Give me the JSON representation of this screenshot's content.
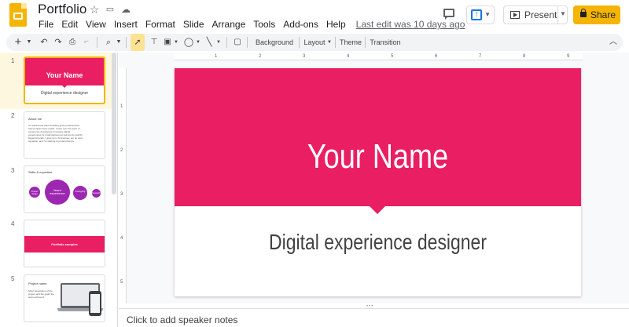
{
  "header": {
    "title": "Portfolio",
    "star_icon": "star-icon",
    "folder_icon": "folder-move-icon",
    "cloud_icon": "cloud-status-icon",
    "last_edit": "Last edit was 10 days ago"
  },
  "menu": [
    "File",
    "Edit",
    "View",
    "Insert",
    "Format",
    "Slide",
    "Arrange",
    "Tools",
    "Add-ons",
    "Help"
  ],
  "actions": {
    "present_label": "Present",
    "share_label": "Share"
  },
  "toolbar": {
    "background_label": "Background",
    "layout_label": "Layout",
    "theme_label": "Theme",
    "transition_label": "Transition"
  },
  "ruler": {
    "h": [
      "1",
      "2",
      "3",
      "4",
      "5",
      "6",
      "7",
      "8",
      "9"
    ],
    "v": [
      "1",
      "2",
      "3",
      "4",
      "5"
    ]
  },
  "slides": [
    {
      "num": "1",
      "title": "Your Name",
      "subtitle": "Digital experience designer"
    },
    {
      "num": "2",
      "title": "About me",
      "body": "I'm passionate about building great products that help people's lives easier. I have over 10 years of experience developing innovative digital experiences for small startups as well as the world's biggest brands. I grew up in Tennessee, am an avid squasher, and I'm starting to protect that joy."
    },
    {
      "num": "3",
      "title": "Skills & expertise",
      "center": "Years' experience",
      "bubbles": [
        "Product design",
        "Prototyping",
        "UX",
        "Research"
      ]
    },
    {
      "num": "4",
      "title": "Portfolio samples"
    },
    {
      "num": "5",
      "title": "Project name",
      "body": "Short description of the project and the goals the team achieved."
    }
  ],
  "main_slide": {
    "title": "Your Name",
    "subtitle": "Digital experience designer",
    "accent": "#e91e63"
  },
  "notes": {
    "placeholder": "Click to add speaker notes"
  },
  "colors": {
    "brand": "#f4b400",
    "accent": "#e91e63",
    "purple": "#9c27b0",
    "blue": "#1a73e8"
  }
}
